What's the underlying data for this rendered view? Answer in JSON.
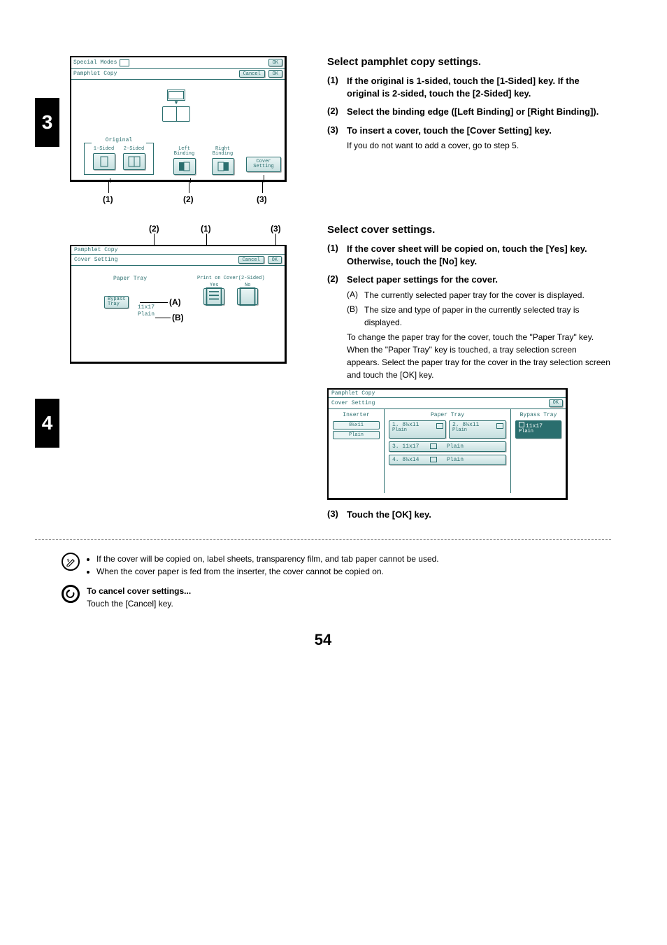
{
  "step3": {
    "number": "3",
    "panel": {
      "special_modes": "Special Modes",
      "ok": "OK",
      "pamphlet_copy": "Pamphlet Copy",
      "cancel": "Cancel",
      "ok2": "OK",
      "original": "Original",
      "one_sided": "1-Sided",
      "two_sided": "2-Sided",
      "left_binding": "Left\nBinding",
      "right_binding": "Right\nBinding",
      "cover_setting": "Cover\nSetting",
      "c1": "(1)",
      "c2": "(2)",
      "c3": "(3)"
    },
    "title": "Select pamphlet copy settings.",
    "items": [
      {
        "num": "(1)",
        "text": "If the original is 1-sided, touch the [1-Sided] key. If the original is 2-sided, touch the [2-Sided] key."
      },
      {
        "num": "(2)",
        "text": "Select the binding edge ([Left Binding] or [Right Binding])."
      },
      {
        "num": "(3)",
        "text": "To insert a cover, touch the [Cover Setting] key.",
        "sub": "If you do not want to add a cover, go to step 5."
      }
    ]
  },
  "step4": {
    "number": "4",
    "panelA": {
      "pamphlet_copy": "Pamphlet Copy",
      "cover_setting": "Cover Setting",
      "cancel": "Cancel",
      "ok": "OK",
      "paper_tray": "Paper Tray",
      "bypass_tray": "Bypass\nTray",
      "size": "11x17",
      "type": "Plain",
      "print_on_cover": "Print on Cover(2-Sided)",
      "yes": "Yes",
      "no": "No",
      "c1": "(1)",
      "c2": "(2)",
      "c3": "(3)",
      "A": "(A)",
      "B": "(B)"
    },
    "panelB": {
      "pamphlet_copy": "Pamphlet Copy",
      "cover_setting": "Cover Setting",
      "ok": "OK",
      "inserter": "Inserter",
      "ins_size": "8½x11",
      "ins_type": "Plain",
      "paper_tray": "Paper Tray",
      "t1": "1. 8½x11",
      "t1t": "Plain",
      "t2": "2. 8½x11",
      "t2t": "Plain",
      "t3": "3. 11x17",
      "t3t": "Plain",
      "t4": "4. 8½x14",
      "t4t": "Plain",
      "bypass_tray": "Bypass Tray",
      "bp_size": "11x17",
      "bp_type": "Plain"
    },
    "title": "Select cover settings.",
    "items": [
      {
        "num": "(1)",
        "text": "If the cover sheet will be copied on, touch the [Yes] key. Otherwise, touch the [No] key."
      },
      {
        "num": "(2)",
        "text": "Select paper settings for the cover.",
        "ab": [
          {
            "l": "(A)",
            "t": "The currently selected paper tray for the cover is displayed."
          },
          {
            "l": "(B)",
            "t": "The size and type of paper in the currently selected tray is displayed."
          }
        ],
        "sub": "To change the paper tray for the cover, touch the \"Paper Tray\" key.\nWhen the \"Paper Tray\" key is touched, a tray selection screen appears. Select the paper tray for the cover in the tray selection screen and touch the [OK] key."
      },
      {
        "num": "(3)",
        "text": "Touch the [OK] key."
      }
    ]
  },
  "notes": {
    "b1": "If the cover will be copied on, label sheets, transparency film, and tab paper cannot be used.",
    "b2": "When the cover paper is fed from the inserter, the cover cannot be copied on.",
    "cancel_title": "To cancel cover settings...",
    "cancel_text": "Touch the [Cancel] key."
  },
  "page_number": "54"
}
